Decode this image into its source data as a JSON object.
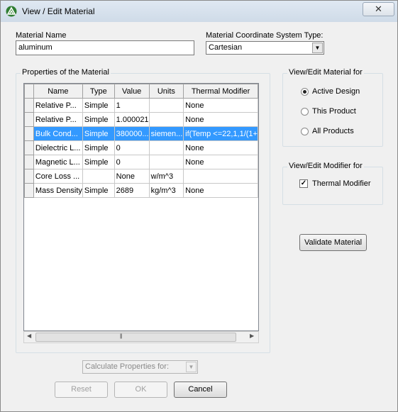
{
  "window": {
    "title": "View / Edit Material",
    "close_glyph": "✕"
  },
  "material_name": {
    "label": "Material Name",
    "value": "aluminum"
  },
  "coord_system": {
    "label": "Material Coordinate System Type:",
    "value": "Cartesian"
  },
  "properties": {
    "group_label": "Properties of the Material",
    "columns": [
      "Name",
      "Type",
      "Value",
      "Units",
      "Thermal Modifier"
    ],
    "rows": [
      {
        "name": "Relative P...",
        "type": "Simple",
        "value": "1",
        "units": "",
        "thermal": "None",
        "selected": false
      },
      {
        "name": "Relative P...",
        "type": "Simple",
        "value": "1.000021",
        "units": "",
        "thermal": "None",
        "selected": false
      },
      {
        "name": "Bulk Cond...",
        "type": "Simple",
        "value": "380000...",
        "units": "siemen...",
        "thermal": "if(Temp <=22,1,1/(1+",
        "selected": true
      },
      {
        "name": "Dielectric L...",
        "type": "Simple",
        "value": "0",
        "units": "",
        "thermal": "None",
        "selected": false
      },
      {
        "name": "Magnetic L...",
        "type": "Simple",
        "value": "0",
        "units": "",
        "thermal": "None",
        "selected": false
      },
      {
        "name": "Core Loss ...",
        "type": "",
        "value": "None",
        "units": "w/m^3",
        "thermal": "",
        "selected": false
      },
      {
        "name": "Mass Density",
        "type": "Simple",
        "value": "2689",
        "units": "kg/m^3",
        "thermal": "None",
        "selected": false
      }
    ]
  },
  "view_material_for": {
    "group_label": "View/Edit Material for",
    "options": [
      {
        "label": "Active Design",
        "checked": true
      },
      {
        "label": "This Product",
        "checked": false
      },
      {
        "label": "All Products",
        "checked": false
      }
    ]
  },
  "view_modifier_for": {
    "group_label": "View/Edit Modifier for",
    "thermal_label": "Thermal Modifier",
    "thermal_checked": true
  },
  "buttons": {
    "validate": "Validate Material",
    "calc_properties": "Calculate Properties for:",
    "reset": "Reset",
    "ok": "OK",
    "cancel": "Cancel"
  },
  "colors": {
    "selection": "#3399ff",
    "window_bg": "#f0f0f0"
  }
}
